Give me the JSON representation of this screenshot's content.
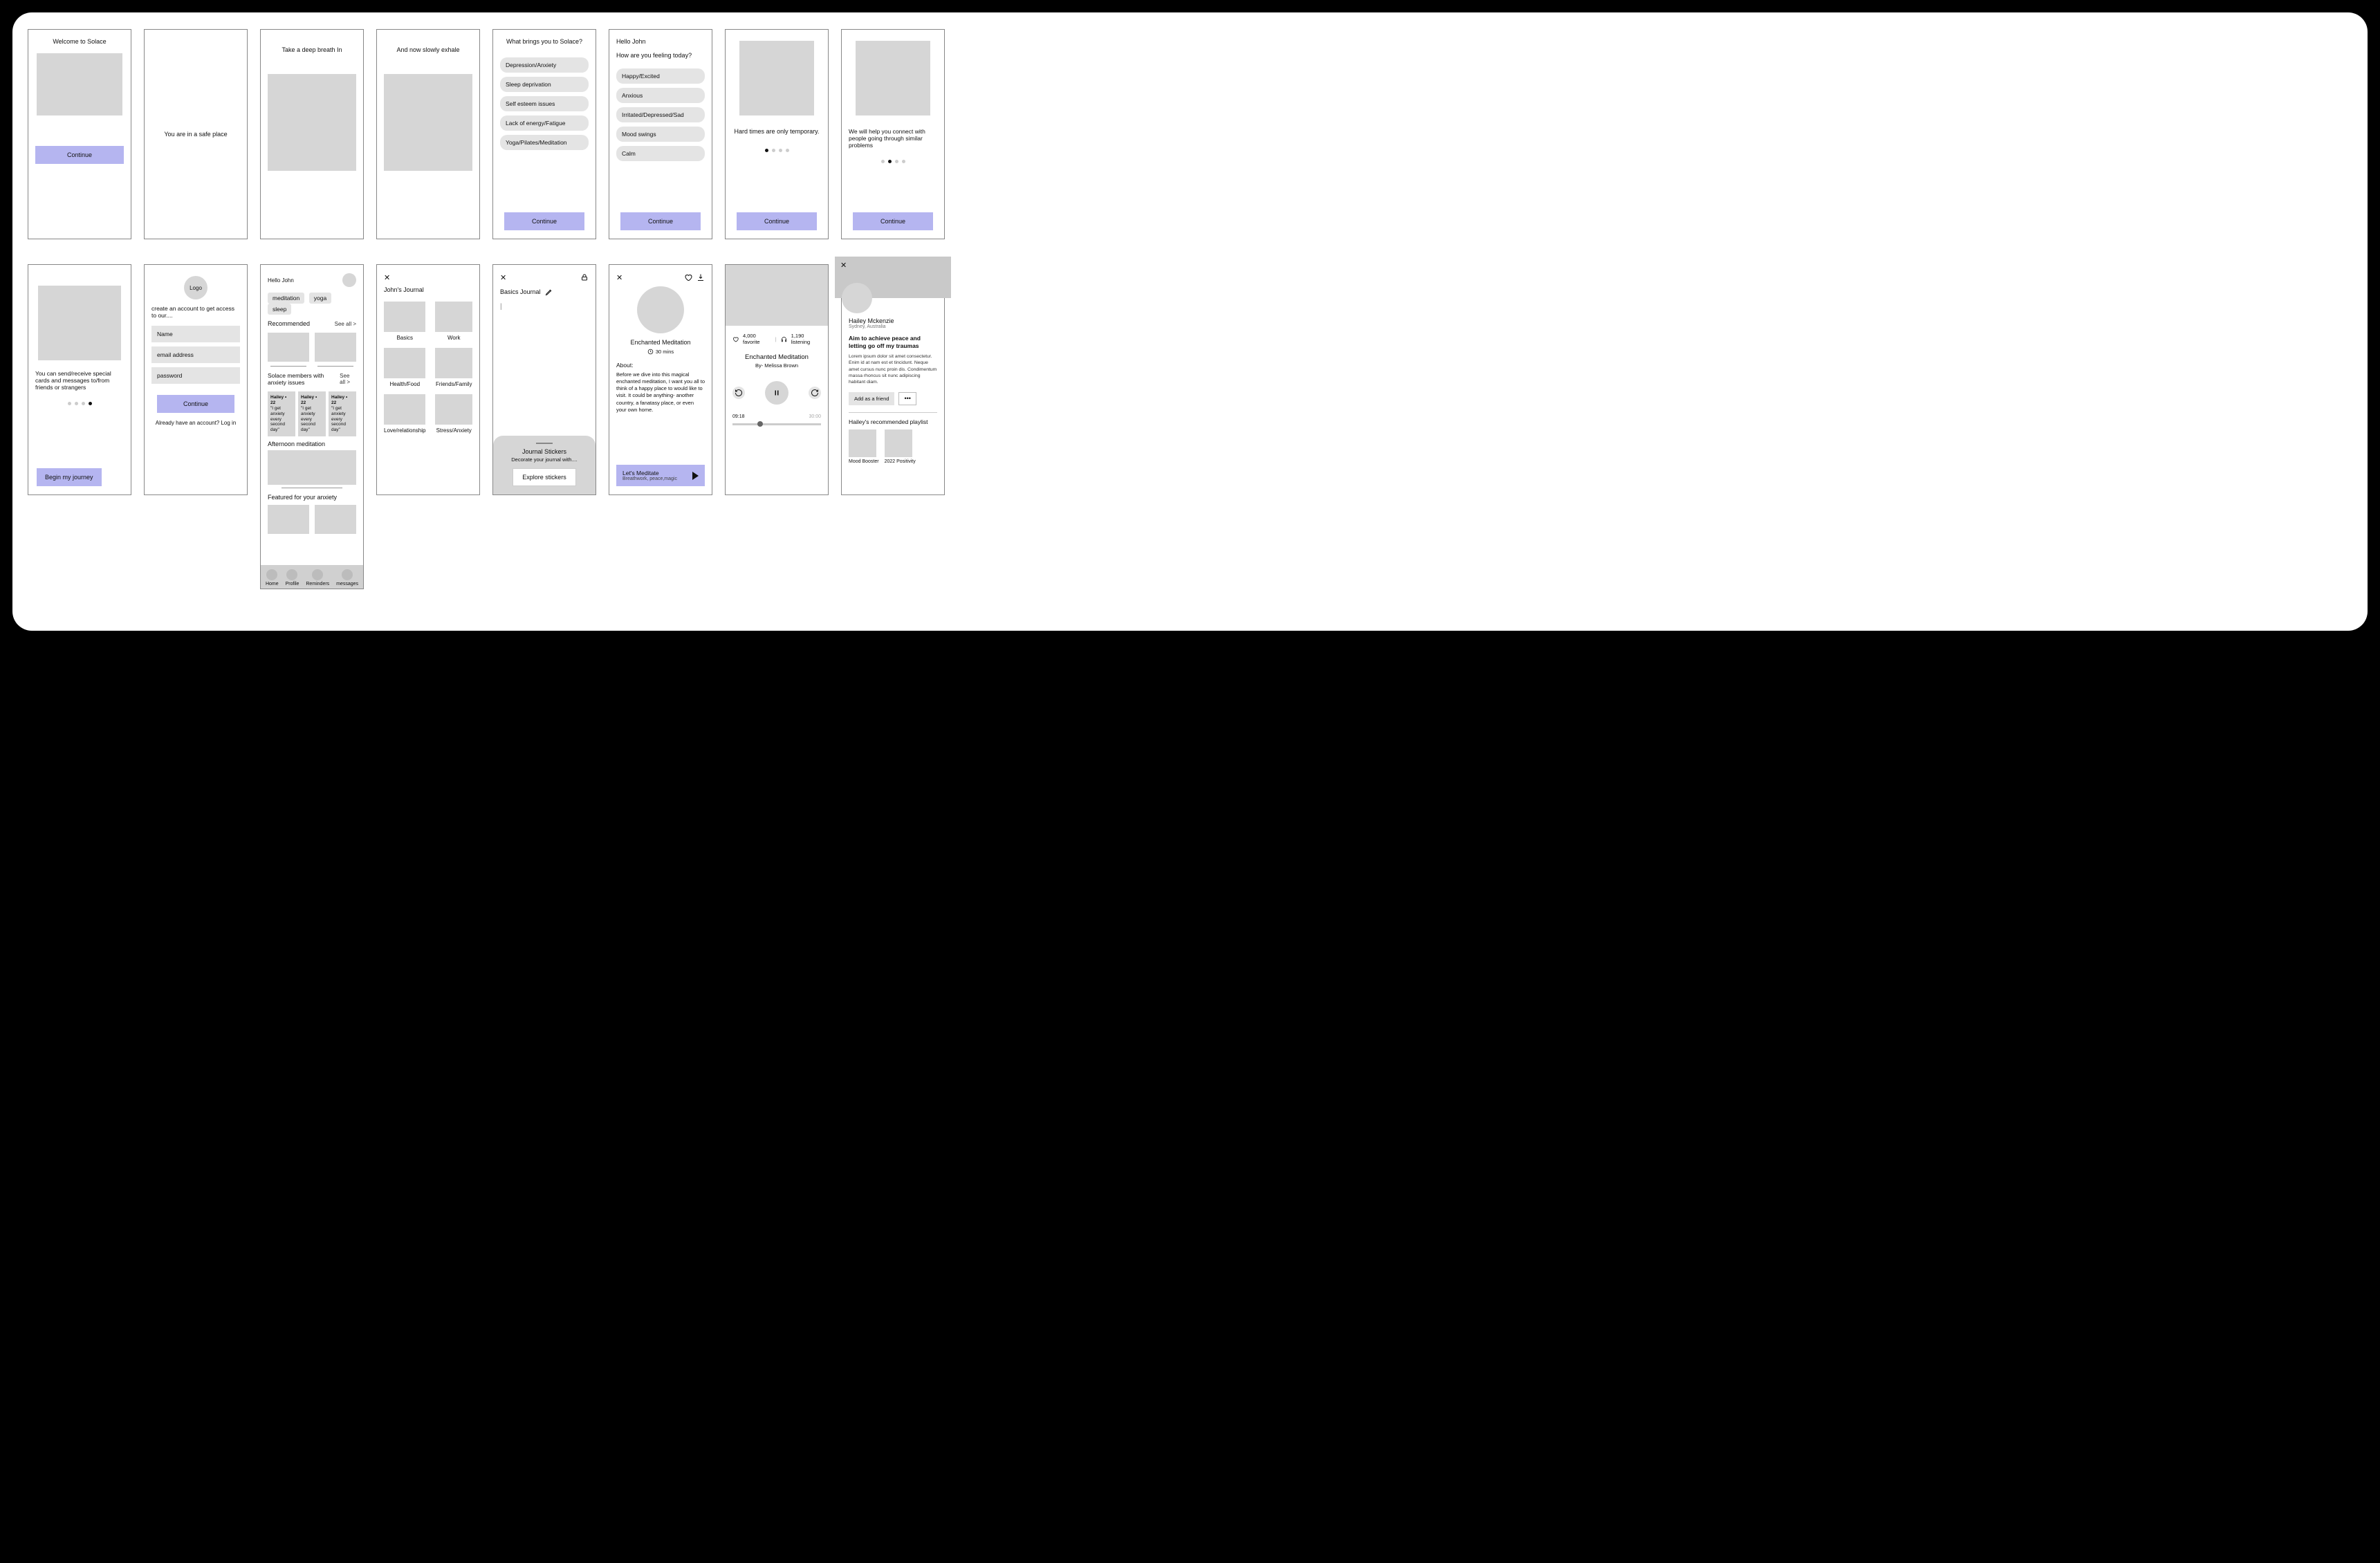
{
  "s1": {
    "title": "Welcome to Solace",
    "cta": "Continue"
  },
  "s2": {
    "text": "You are in a safe place"
  },
  "s3": {
    "text": "Take a deep breath In"
  },
  "s4": {
    "text": "And now slowly exhale"
  },
  "s5": {
    "title": "What brings you to Solace?",
    "opts": [
      "Depression/Anxiety",
      "Sleep deprivation",
      "Self esteem issues",
      "Lack of energy/Fatigue",
      "Yoga/Pilates/Meditation"
    ],
    "cta": "Continue"
  },
  "s6": {
    "greet": "Hello John",
    "q": "How are you feeling today?",
    "opts": [
      "Happy/Excited",
      "Anxious",
      "Irritated/Depressed/Sad",
      "Mood swings",
      "Calm"
    ],
    "cta": "Continue"
  },
  "s7": {
    "text": "Hard times are only temporary.",
    "cta": "Continue"
  },
  "s8": {
    "text": "We will help you connect with people going through similar problems",
    "cta": "Continue"
  },
  "s9": {
    "text": "You can send/receive special cards and messages to/from friends or strangers",
    "cta": "Begin my journey"
  },
  "s10": {
    "logo": "Logo",
    "sub": "create an account to get access to our....",
    "fields": {
      "name": "Name",
      "email": "email address",
      "pass": "password"
    },
    "cta": "Continue",
    "login": "Already have an account? Log in"
  },
  "s11": {
    "greet": "Hello John",
    "tags": [
      "meditation",
      "yoga",
      "sleep"
    ],
    "rec": "Recommended",
    "see": "See all >",
    "members": "Solace members with anxiety issues",
    "card": {
      "name": "Hailey • 22",
      "quote": "\"I get anxiety every second day\""
    },
    "afternoon": "Afternoon meditation",
    "featured": "Featured for your anxiety",
    "nav": [
      "Home",
      "Profile",
      "Reminders",
      "messages"
    ]
  },
  "s12": {
    "title": "John's Journal",
    "cats": [
      "Basics",
      "Work",
      "Health/Food",
      "Friends/Family",
      "Love/relationship",
      "Stress/Anxiety"
    ]
  },
  "s13": {
    "title": "Basics Journal",
    "stickers_title": "Journal Stickers",
    "stickers_sub": "Decorate your journal with....",
    "stickers_cta": "Explore stickers"
  },
  "s14": {
    "title": "Enchanted Meditation",
    "duration": "30 mins",
    "about_label": "About:",
    "about": "Before we dive into this magical enchanted meditation, I want you all to think of a happy place to would like to visit. It could be anything- another country, a fanatasy place, or even your own home.",
    "play": "Let's Meditate",
    "play_sub": "Breathwork, peace,magic"
  },
  "s15": {
    "fav": "4,000 favorite",
    "listening": "1,190 listening",
    "title": "Enchanted Meditation",
    "by": "By- Melissa Brown",
    "t1": "09:18",
    "t2": "30:00"
  },
  "s16": {
    "name": "Hailey Mckenzie",
    "loc": "Sydney, Australia",
    "headline": "Aim to achieve peace and letting go off my traumas",
    "bio": "Lorem ipsum dolor sit amet consectetur. Enim id at nam est et tincidunt. Neque amet cursus nunc proin dis. Condimentum massa rhoncus sit nunc adipiscing habitant diam.",
    "add": "Add as a friend",
    "rec": "Hailey's recommended playlist",
    "pl1": "Mood Booster",
    "pl2": "2022 Positivity"
  }
}
